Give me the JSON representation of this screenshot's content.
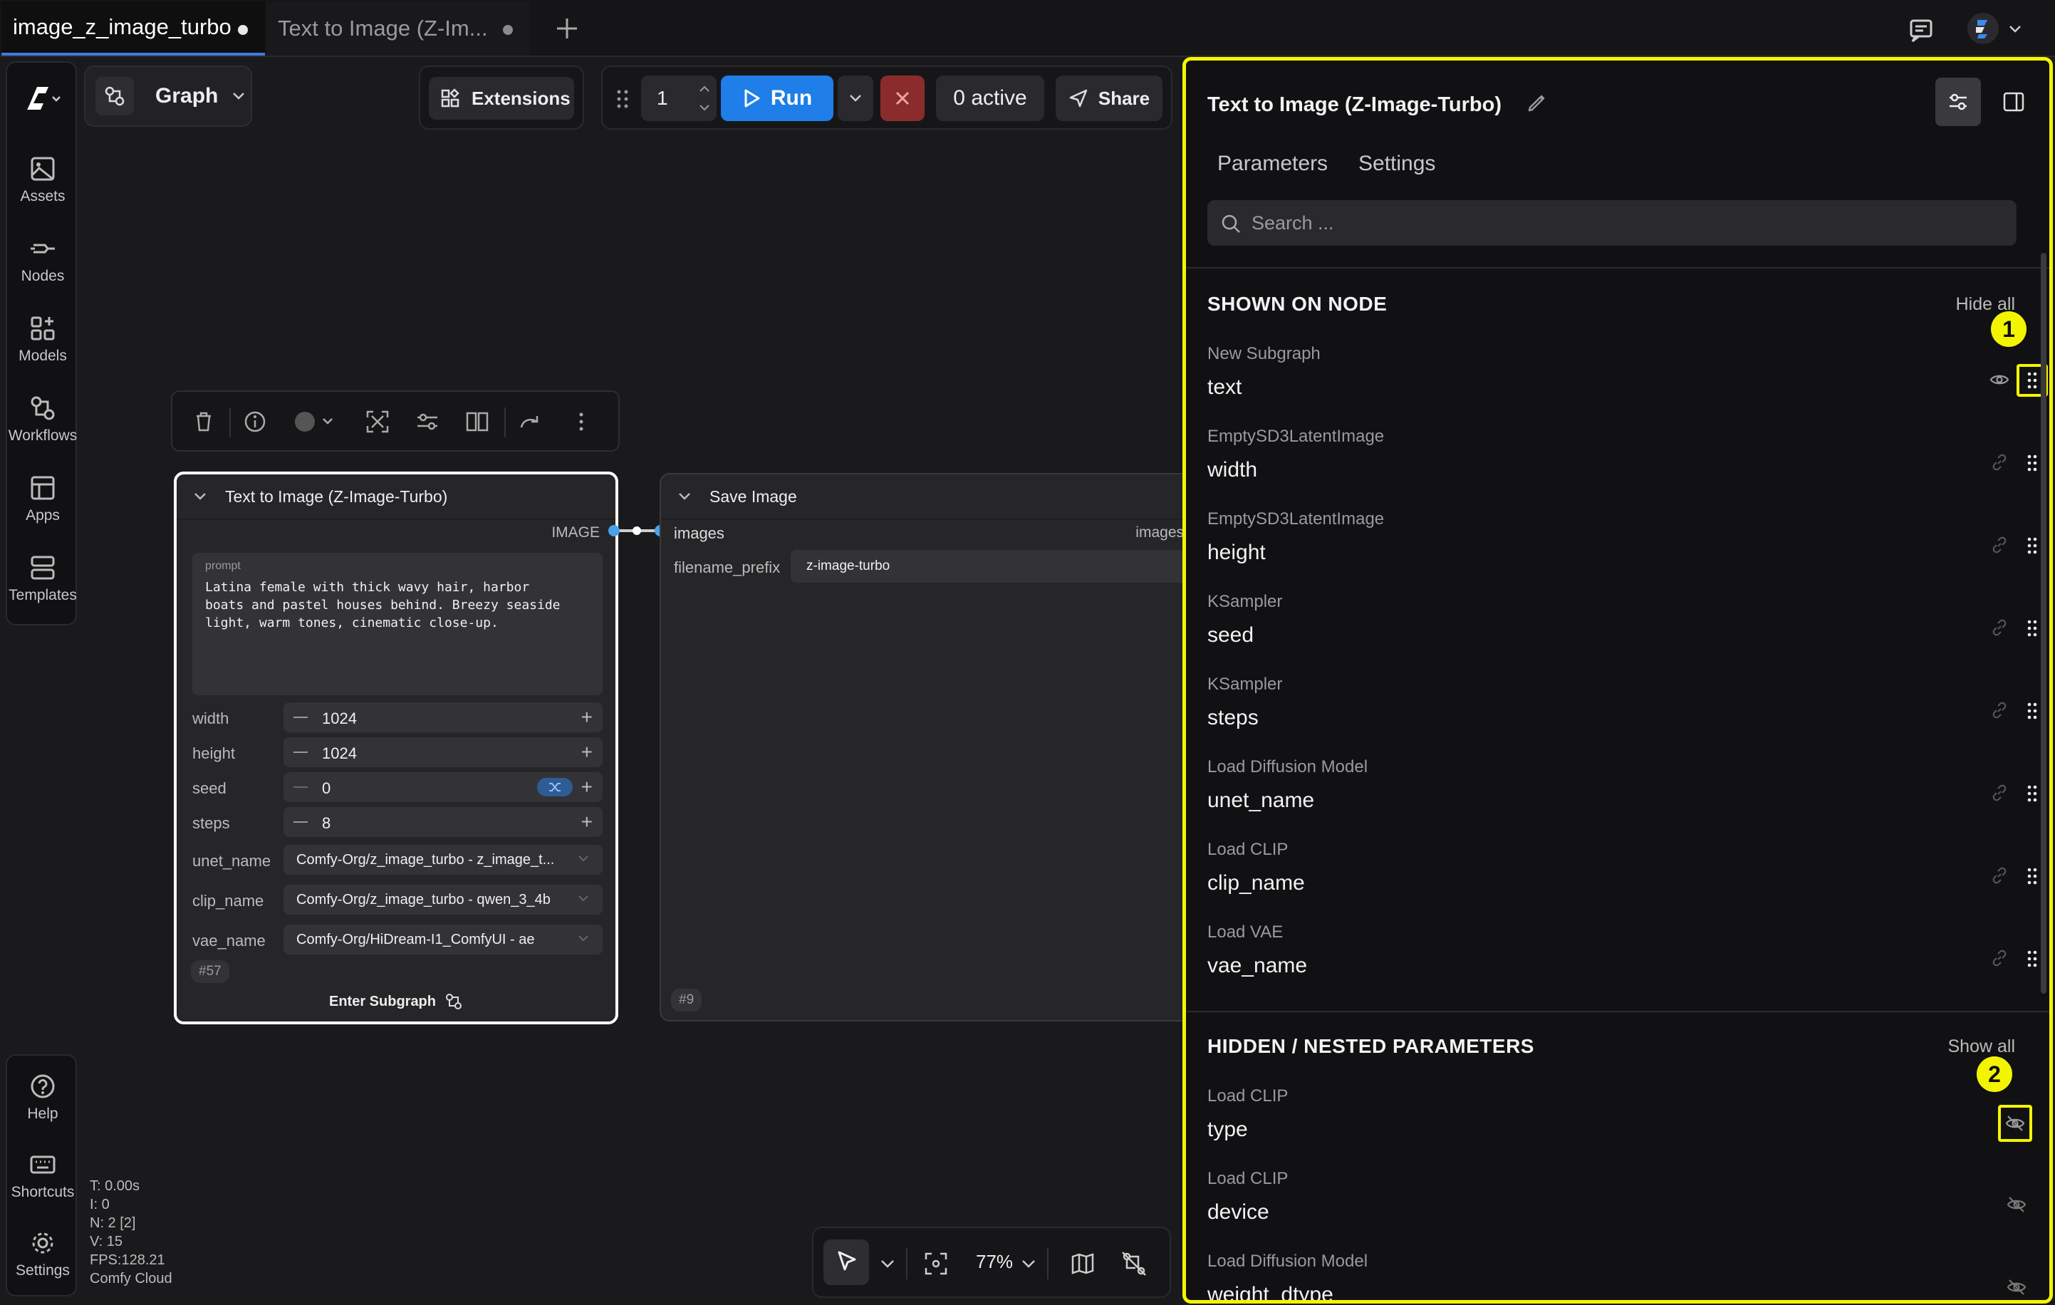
{
  "tabs": [
    {
      "label": "image_z_image_turbo",
      "active": true
    },
    {
      "label": "Text to Image (Z-Im...",
      "active": false
    }
  ],
  "sidebar": {
    "items": [
      {
        "label": "Assets",
        "icon": "image-icon"
      },
      {
        "label": "Nodes",
        "icon": "node-icon"
      },
      {
        "label": "Models",
        "icon": "models-icon"
      },
      {
        "label": "Workflows",
        "icon": "workflow-icon"
      },
      {
        "label": "Apps",
        "icon": "apps-icon"
      },
      {
        "label": "Templates",
        "icon": "templates-icon"
      }
    ],
    "bottom": [
      {
        "label": "Help",
        "icon": "help-icon"
      },
      {
        "label": "Shortcuts",
        "icon": "keyboard-icon"
      },
      {
        "label": "Settings",
        "icon": "gear-icon"
      }
    ]
  },
  "toolbar": {
    "graph_label": "Graph",
    "extensions_label": "Extensions",
    "queue_count": "1",
    "run_label": "Run",
    "active_label": "0 active",
    "share_label": "Share"
  },
  "subgraph_node": {
    "title": "Text to Image (Z-Image-Turbo)",
    "output_label": "IMAGE",
    "prompt_label": "prompt",
    "prompt_text": "Latina female with thick wavy hair, harbor\nboats and pastel houses behind. Breezy seaside\nlight, warm tones, cinematic close-up.",
    "widgets": {
      "width": {
        "label": "width",
        "value": "1024"
      },
      "height": {
        "label": "height",
        "value": "1024"
      },
      "seed": {
        "label": "seed",
        "value": "0"
      },
      "steps": {
        "label": "steps",
        "value": "8"
      },
      "unet_name": {
        "label": "unet_name",
        "value": "Comfy-Org/z_image_turbo - z_image_t..."
      },
      "clip_name": {
        "label": "clip_name",
        "value": "Comfy-Org/z_image_turbo - qwen_3_4b"
      },
      "vae_name": {
        "label": "vae_name",
        "value": "Comfy-Org/HiDream-I1_ComfyUI - ae"
      }
    },
    "id": "#57",
    "enter_label": "Enter Subgraph"
  },
  "save_node": {
    "title": "Save Image",
    "input_label": "images",
    "output_label": "images",
    "prefix_label": "filename_prefix",
    "prefix_value": "z-image-turbo",
    "id": "#9"
  },
  "stats": {
    "t": "T: 0.00s",
    "i": "I: 0",
    "n": "N: 2 [2]",
    "v": "V: 15",
    "fps": "FPS:128.21",
    "env": "Comfy Cloud"
  },
  "canvas_tools": {
    "zoom": "77%"
  },
  "panel": {
    "title": "Text to Image (Z-Image-Turbo)",
    "tabs": [
      "Parameters",
      "Settings"
    ],
    "search_placeholder": "Search ...",
    "shown_section": {
      "title": "SHOWN ON NODE",
      "action": "Hide all",
      "rows": [
        {
          "source": "New Subgraph",
          "name": "text",
          "icon": "eye-icon"
        },
        {
          "source": "EmptySD3LatentImage",
          "name": "width",
          "icon": "link-icon"
        },
        {
          "source": "EmptySD3LatentImage",
          "name": "height",
          "icon": "link-icon"
        },
        {
          "source": "KSampler",
          "name": "seed",
          "icon": "link-icon"
        },
        {
          "source": "KSampler",
          "name": "steps",
          "icon": "link-icon"
        },
        {
          "source": "Load Diffusion Model",
          "name": "unet_name",
          "icon": "link-icon"
        },
        {
          "source": "Load CLIP",
          "name": "clip_name",
          "icon": "link-icon"
        },
        {
          "source": "Load VAE",
          "name": "vae_name",
          "icon": "link-icon"
        }
      ]
    },
    "hidden_section": {
      "title": "HIDDEN / NESTED PARAMETERS",
      "action": "Show all",
      "rows": [
        {
          "source": "Load CLIP",
          "name": "type",
          "icon": "eye-off-icon"
        },
        {
          "source": "Load CLIP",
          "name": "device",
          "icon": "eye-off-icon"
        },
        {
          "source": "Load Diffusion Model",
          "name": "weight_dtype",
          "icon": "eye-off-icon"
        }
      ]
    },
    "annotations": [
      "1",
      "2"
    ]
  },
  "colors": {
    "accent": "#1f7ee8",
    "highlight": "#f3f500",
    "cancel": "#8a2c2c"
  }
}
